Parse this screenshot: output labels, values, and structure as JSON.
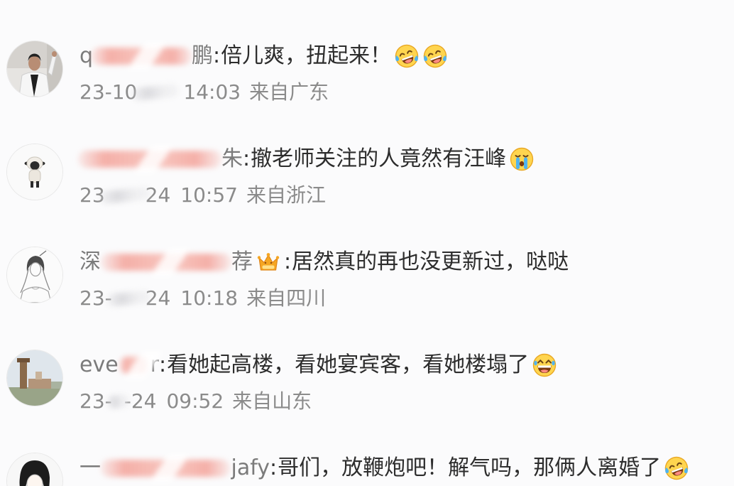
{
  "colors": {
    "background": "#fbfbfc",
    "comment_text": "#2d2d2d",
    "username": "#7b7b7b",
    "meta": "#8b8b8b",
    "redaction": "#f29a90"
  },
  "comments": [
    {
      "username_start": "q",
      "username_end": "鹏",
      "separator": ":",
      "text": "倍儿爽，扭起来！",
      "emojis": [
        "laugh-cry-icon",
        "laugh-cry-icon"
      ],
      "date_start": "23-10",
      "time": "14:03",
      "location": "来自广东"
    },
    {
      "username_end": "朱",
      "separator": ":",
      "text": "撤老师关注的人竟然有汪峰",
      "emojis": [
        "tears-icon"
      ],
      "date_start": "23",
      "date_end": "24",
      "time": "10:57",
      "location": "来自浙江"
    },
    {
      "username_start": "深",
      "username_end": "荐",
      "badge_icon": "vip-crown-icon",
      "separator": ":",
      "text": "居然真的再也没更新过，哒哒",
      "emojis": [],
      "date_start": "23-",
      "date_end": "24",
      "time": "10:18",
      "location": "来自四川"
    },
    {
      "username_start": "eve",
      "username_end": "r",
      "separator": ":",
      "text": "看她起高楼，看她宴宾客，看她楼塌了",
      "emojis": [
        "grin-tears-icon"
      ],
      "date_start": "23-",
      "date_end": "-24",
      "time": "09:52",
      "location": "来自山东"
    },
    {
      "username_start": "一",
      "username_end": "jafy",
      "separator": ":",
      "text": "哥们，放鞭炮吧！解气吗，那俩人离婚了",
      "emojis": [
        "laugh-cry-icon"
      ]
    }
  ]
}
